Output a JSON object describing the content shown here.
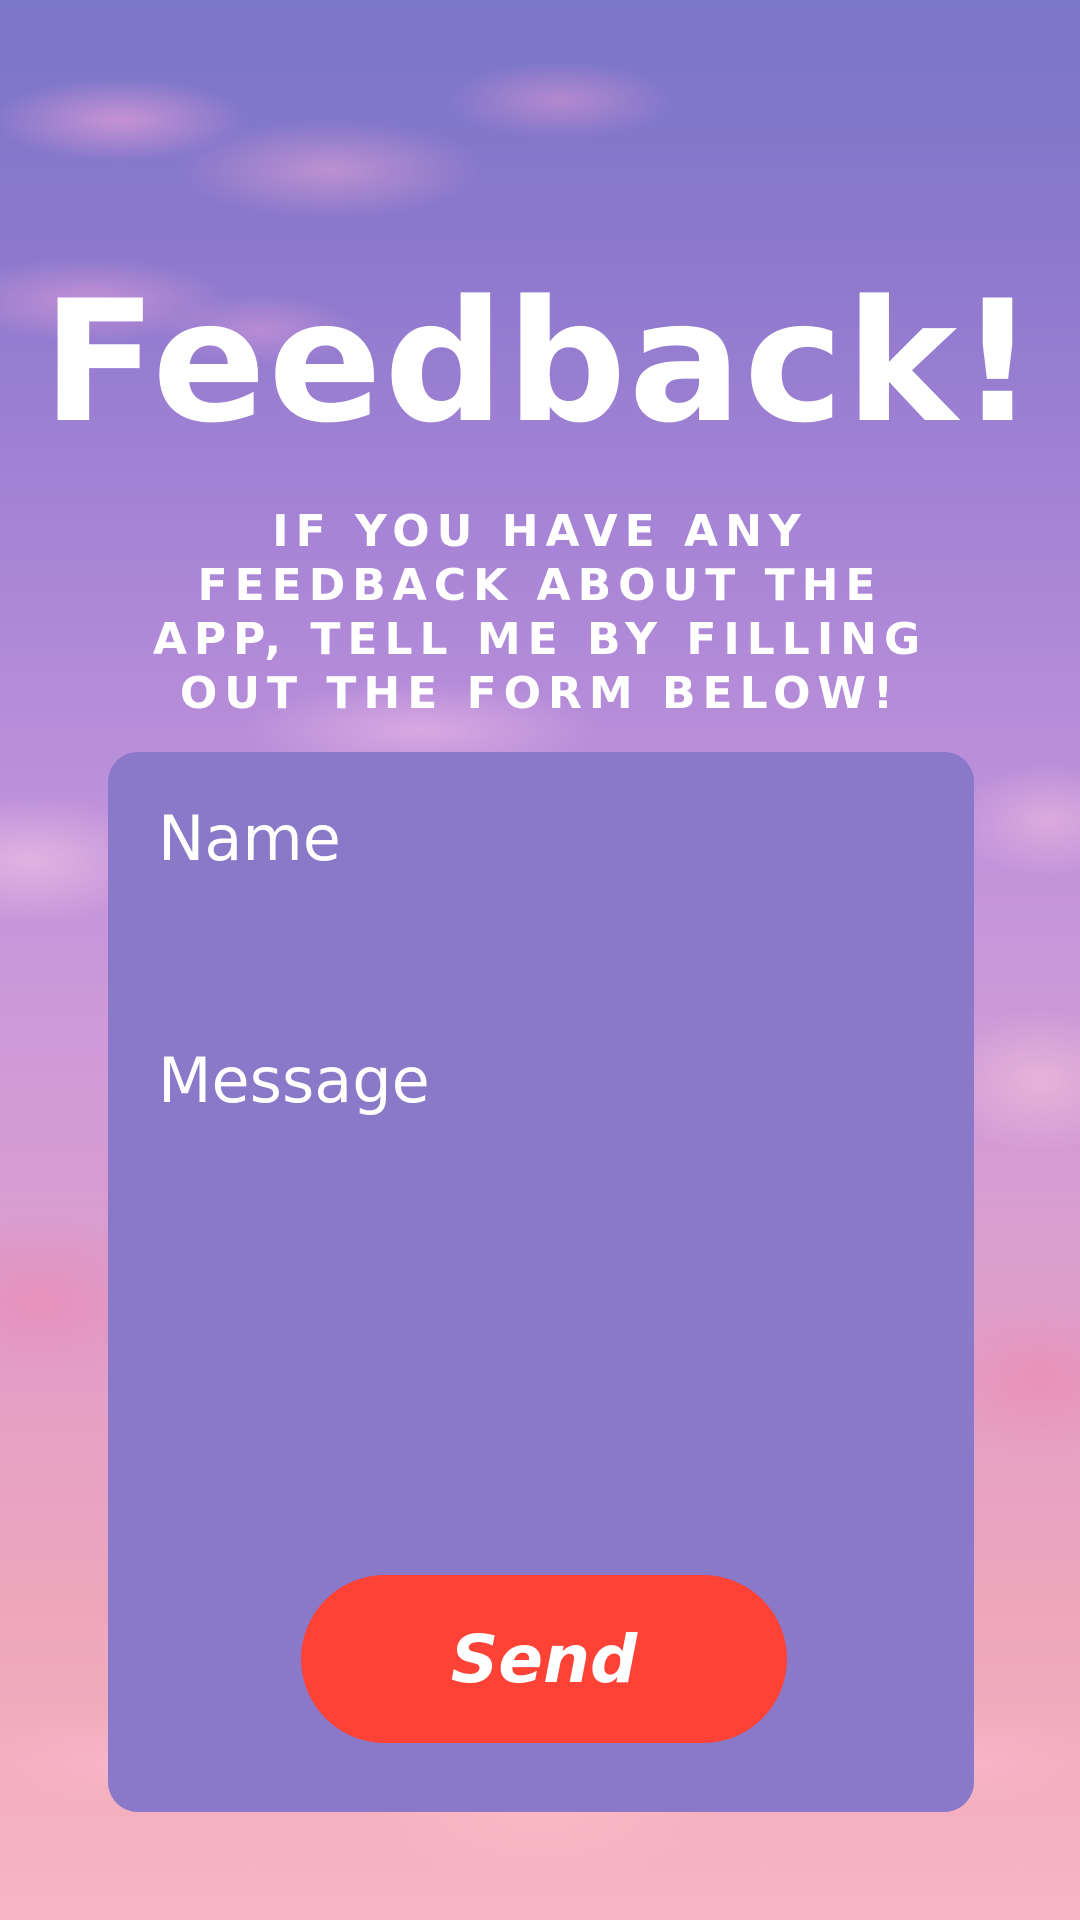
{
  "header": {
    "title": "Feedback!",
    "subtitle": "IF YOU HAVE ANY FEEDBACK ABOUT THE APP, TELL ME BY FILLING OUT THE FORM BELOW!"
  },
  "form": {
    "name_label": "Name",
    "name_value": "",
    "message_label": "Message",
    "message_value": "",
    "send_label": "Send"
  },
  "colors": {
    "card": "#8a78c8",
    "button": "#ff4236",
    "text": "#ffffff"
  }
}
